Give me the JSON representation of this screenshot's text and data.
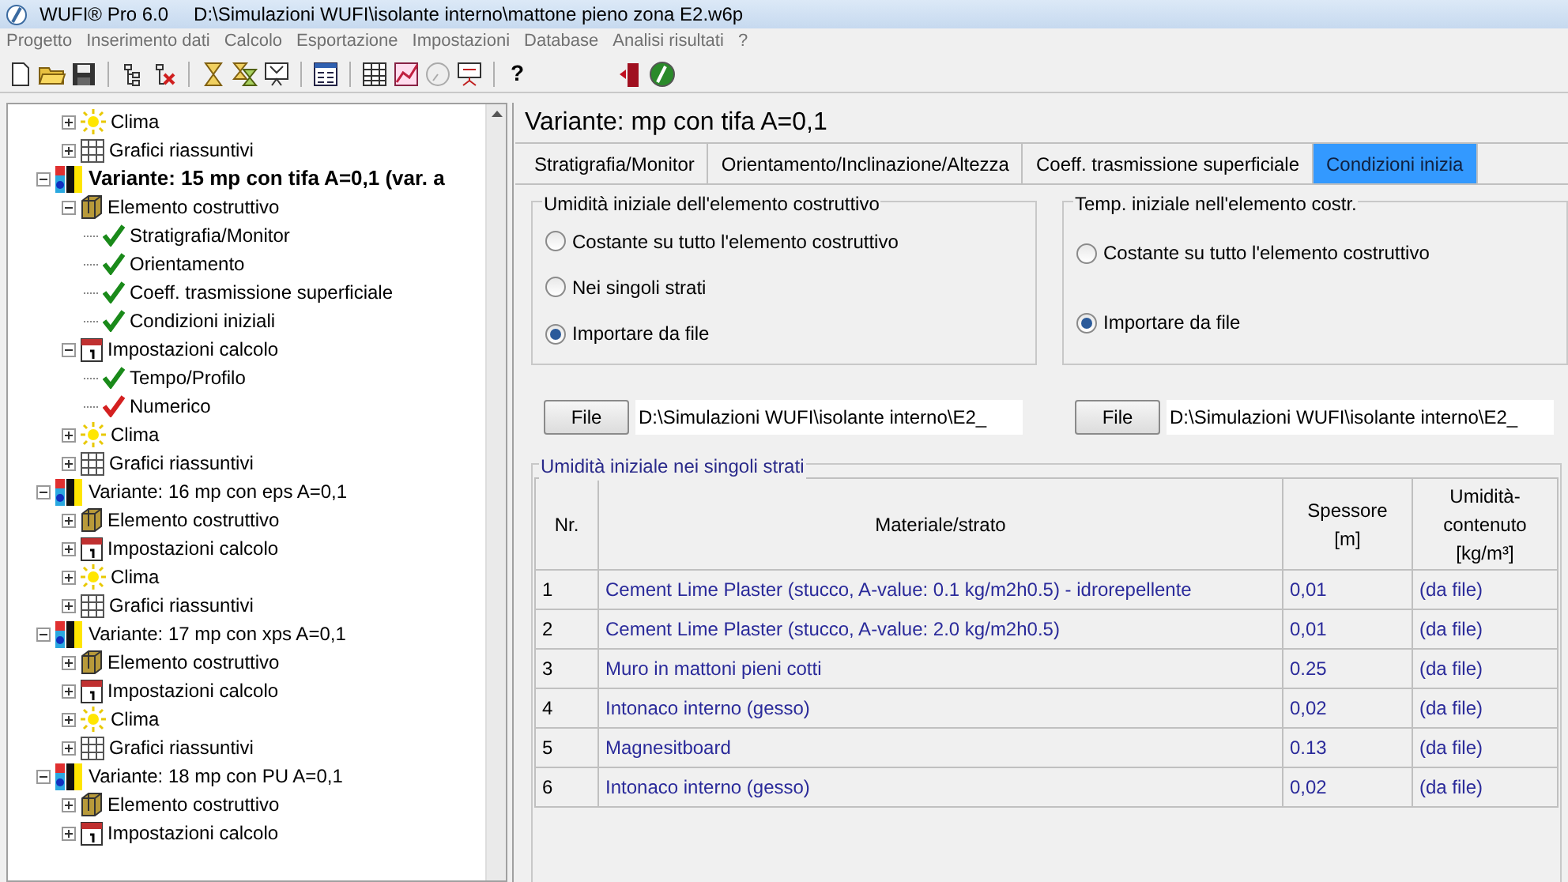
{
  "window": {
    "app": "WUFI® Pro 6.0",
    "file": "D:\\Simulazioni WUFI\\isolante interno\\mattone pieno zona E2.w6p"
  },
  "menu": [
    "Progetto",
    "Inserimento dati",
    "Calcolo",
    "Esportazione",
    "Impostazioni",
    "Database",
    "Analisi risultati",
    "?"
  ],
  "toolbar_help": "?",
  "tree": {
    "preceding_children": [
      {
        "label": "Clima",
        "kind": "climate",
        "expanded": false
      },
      {
        "label": "Grafici riassuntivi",
        "kind": "charts",
        "expanded": false
      }
    ],
    "variants": [
      {
        "label": "Variante: 15 mp con tifa A=0,1 (var. a",
        "current": true,
        "expanded": true,
        "children": [
          {
            "label": "Elemento costruttivo",
            "kind": "element",
            "expanded": true,
            "children": [
              {
                "label": "Stratigrafia/Monitor",
                "kind": "check",
                "color": "#1a8a1a"
              },
              {
                "label": "Orientamento",
                "kind": "check",
                "color": "#1a8a1a"
              },
              {
                "label": "Coeff. trasmissione superficiale",
                "kind": "check",
                "color": "#1a8a1a"
              },
              {
                "label": "Condizioni iniziali",
                "kind": "check",
                "color": "#1a8a1a"
              }
            ]
          },
          {
            "label": "Impostazioni calcolo",
            "kind": "settings",
            "expanded": true,
            "children": [
              {
                "label": "Tempo/Profilo",
                "kind": "check",
                "color": "#1a8a1a"
              },
              {
                "label": "Numerico",
                "kind": "check",
                "color": "#d42020"
              }
            ]
          },
          {
            "label": "Clima",
            "kind": "climate",
            "expanded": false
          },
          {
            "label": "Grafici riassuntivi",
            "kind": "charts",
            "expanded": false
          }
        ]
      },
      {
        "label": "Variante: 16 mp con  eps A=0,1",
        "current": false,
        "expanded": true,
        "children": [
          {
            "label": "Elemento costruttivo",
            "kind": "element",
            "expanded": false
          },
          {
            "label": "Impostazioni calcolo",
            "kind": "settings",
            "expanded": false
          },
          {
            "label": "Clima",
            "kind": "climate",
            "expanded": false
          },
          {
            "label": "Grafici riassuntivi",
            "kind": "charts",
            "expanded": false
          }
        ]
      },
      {
        "label": "Variante: 17 mp con xps A=0,1",
        "current": false,
        "expanded": true,
        "children": [
          {
            "label": "Elemento costruttivo",
            "kind": "element",
            "expanded": false
          },
          {
            "label": "Impostazioni calcolo",
            "kind": "settings",
            "expanded": false
          },
          {
            "label": "Clima",
            "kind": "climate",
            "expanded": false
          },
          {
            "label": "Grafici riassuntivi",
            "kind": "charts",
            "expanded": false
          }
        ]
      },
      {
        "label": "Variante: 18 mp con PU A=0,1",
        "current": false,
        "expanded": true,
        "children": [
          {
            "label": "Elemento costruttivo",
            "kind": "element",
            "expanded": false
          },
          {
            "label": "Impostazioni calcolo",
            "kind": "settings",
            "expanded": false
          }
        ]
      }
    ]
  },
  "header": "Variante:  mp con tifa A=0,1",
  "tabs": [
    {
      "label": "Stratigrafia/Monitor",
      "selected": false
    },
    {
      "label": "Orientamento/Inclinazione/Altezza",
      "selected": false
    },
    {
      "label": "Coeff. trasmissione superficiale",
      "selected": false
    },
    {
      "label": "Condizioni inizia",
      "selected": true
    }
  ],
  "groups": [
    {
      "title": "Umidità iniziale dell'elemento costruttivo",
      "options": [
        {
          "label": "Costante su tutto l'elemento costruttivo",
          "selected": false
        },
        {
          "label": "Nei singoli strati",
          "selected": false
        },
        {
          "label": "Importare da file",
          "selected": true
        }
      ],
      "button": "File",
      "path": "D:\\Simulazioni WUFI\\isolante interno\\E2_"
    },
    {
      "title": "Temp. iniziale nell'elemento costr.",
      "options": [
        {
          "label": "Costante su tutto l'elemento costruttivo",
          "selected": false
        },
        {
          "label": "Importare da file",
          "selected": true
        }
      ],
      "button": "File",
      "path": "D:\\Simulazioni WUFI\\isolante interno\\E2_"
    }
  ],
  "layers": {
    "title": "Umidità iniziale nei singoli strati",
    "columns": [
      {
        "lines": [
          "Nr."
        ]
      },
      {
        "lines": [
          "Materiale/strato"
        ]
      },
      {
        "lines": [
          "Spessore",
          "[m]"
        ]
      },
      {
        "lines": [
          "Umidità-",
          "contenuto",
          "[kg/m³]"
        ]
      }
    ],
    "rows": [
      [
        "1",
        "Cement Lime Plaster (stucco, A-value: 0.1 kg/m2h0.5) - idrorepellente",
        "0,01",
        "(da file)"
      ],
      [
        "2",
        "Cement Lime Plaster (stucco, A-value: 2.0 kg/m2h0.5)",
        "0,01",
        "(da file)"
      ],
      [
        "3",
        "Muro in mattoni pieni cotti",
        "0.25",
        "(da file)"
      ],
      [
        "4",
        "Intonaco interno (gesso)",
        "0,02",
        "(da file)"
      ],
      [
        "5",
        "Magnesitboard",
        "0.13",
        "(da file)"
      ],
      [
        "6",
        "Intonaco interno (gesso)",
        "0,02",
        "(da file)"
      ]
    ]
  }
}
